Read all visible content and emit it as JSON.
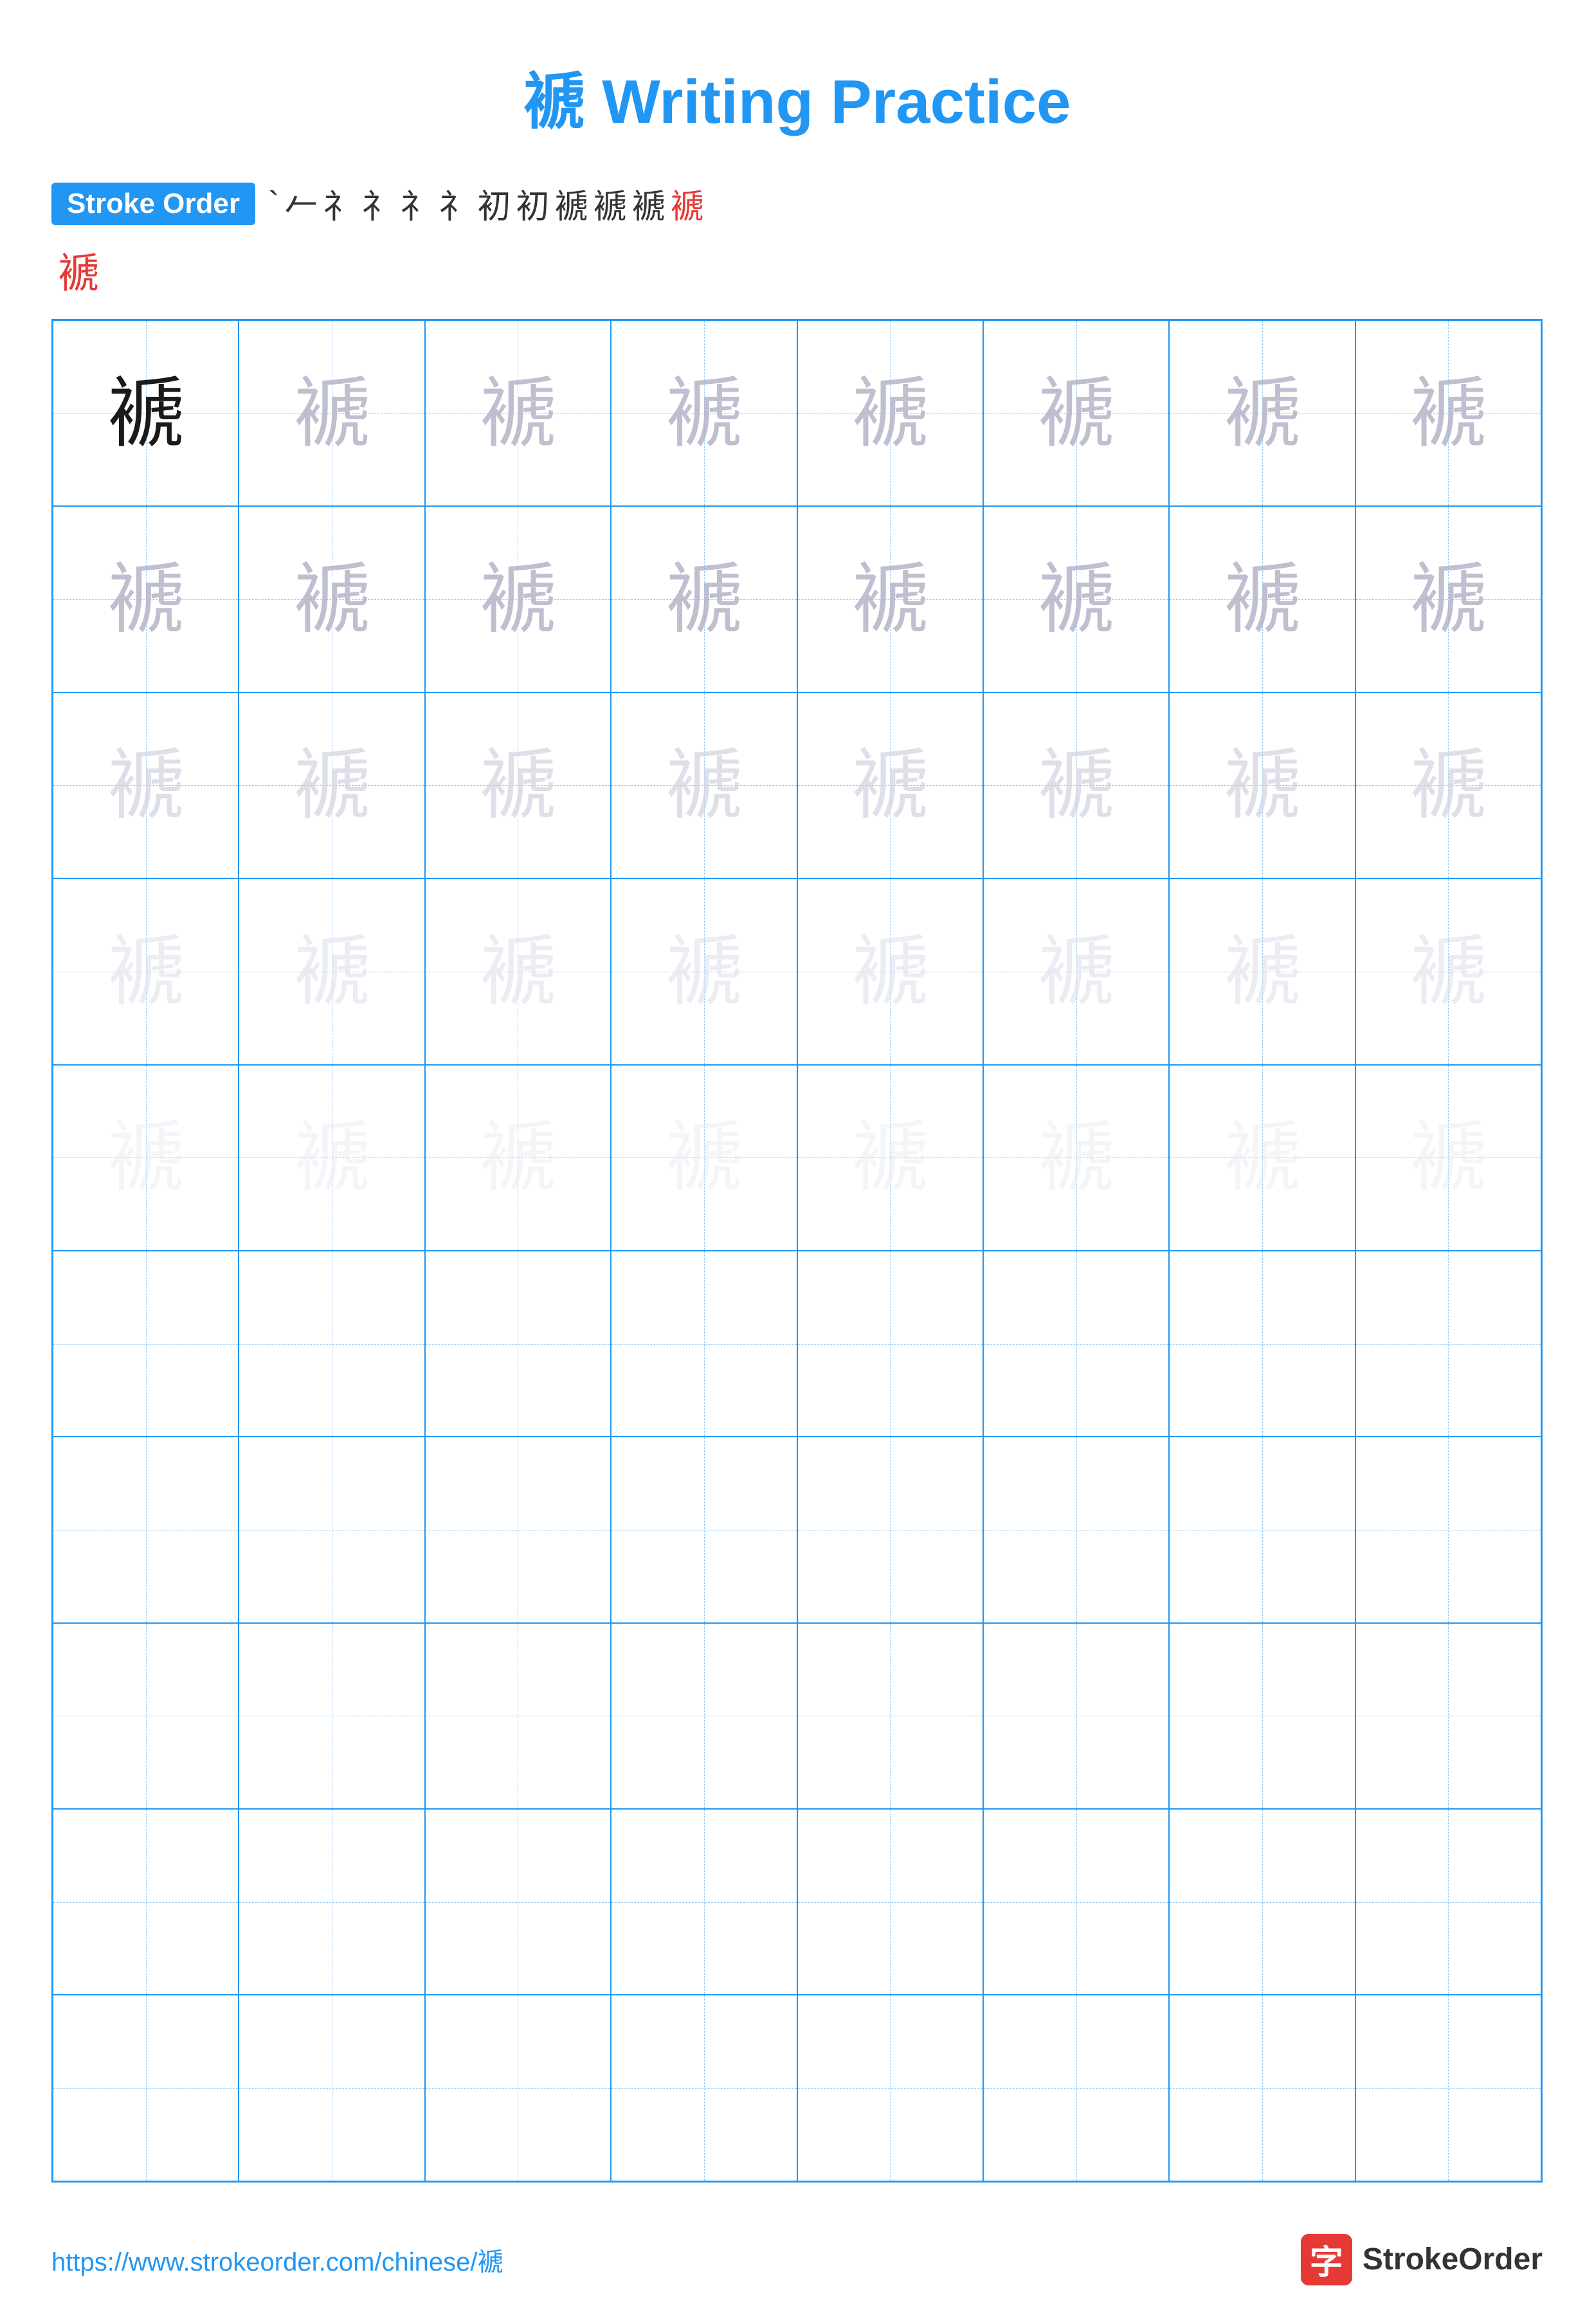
{
  "title": "褫 Writing Practice",
  "stroke_order": {
    "badge_label": "Stroke Order",
    "strokes": [
      "丶",
      "ㄅ",
      "㇀",
      "㇂",
      "㇂",
      "㇂",
      "㇂",
      "㇂",
      "褫",
      "褫",
      "褫",
      "褫"
    ],
    "display_strokes": [
      "`",
      "ㄅ",
      "礻",
      "礻",
      "礻",
      "礻",
      "礻",
      "初",
      "褫",
      "褫",
      "褫",
      "褫"
    ]
  },
  "character": "褫",
  "grid": {
    "rows": 10,
    "cols": 8,
    "practice_rows": [
      [
        "dark",
        "medium",
        "medium",
        "medium",
        "medium",
        "medium",
        "medium",
        "medium"
      ],
      [
        "medium",
        "medium",
        "medium",
        "medium",
        "medium",
        "medium",
        "medium",
        "medium"
      ],
      [
        "light",
        "light",
        "light",
        "light",
        "light",
        "light",
        "light",
        "light"
      ],
      [
        "lighter",
        "lighter",
        "lighter",
        "lighter",
        "lighter",
        "lighter",
        "lighter",
        "lighter"
      ],
      [
        "lightest",
        "lightest",
        "lightest",
        "lightest",
        "lightest",
        "lightest",
        "lightest",
        "lightest"
      ],
      [
        "empty",
        "empty",
        "empty",
        "empty",
        "empty",
        "empty",
        "empty",
        "empty"
      ],
      [
        "empty",
        "empty",
        "empty",
        "empty",
        "empty",
        "empty",
        "empty",
        "empty"
      ],
      [
        "empty",
        "empty",
        "empty",
        "empty",
        "empty",
        "empty",
        "empty",
        "empty"
      ],
      [
        "empty",
        "empty",
        "empty",
        "empty",
        "empty",
        "empty",
        "empty",
        "empty"
      ],
      [
        "empty",
        "empty",
        "empty",
        "empty",
        "empty",
        "empty",
        "empty",
        "empty"
      ]
    ]
  },
  "footer": {
    "url": "https://www.strokeorder.com/chinese/褫",
    "brand_name": "StrokeOrder",
    "brand_char": "字"
  }
}
